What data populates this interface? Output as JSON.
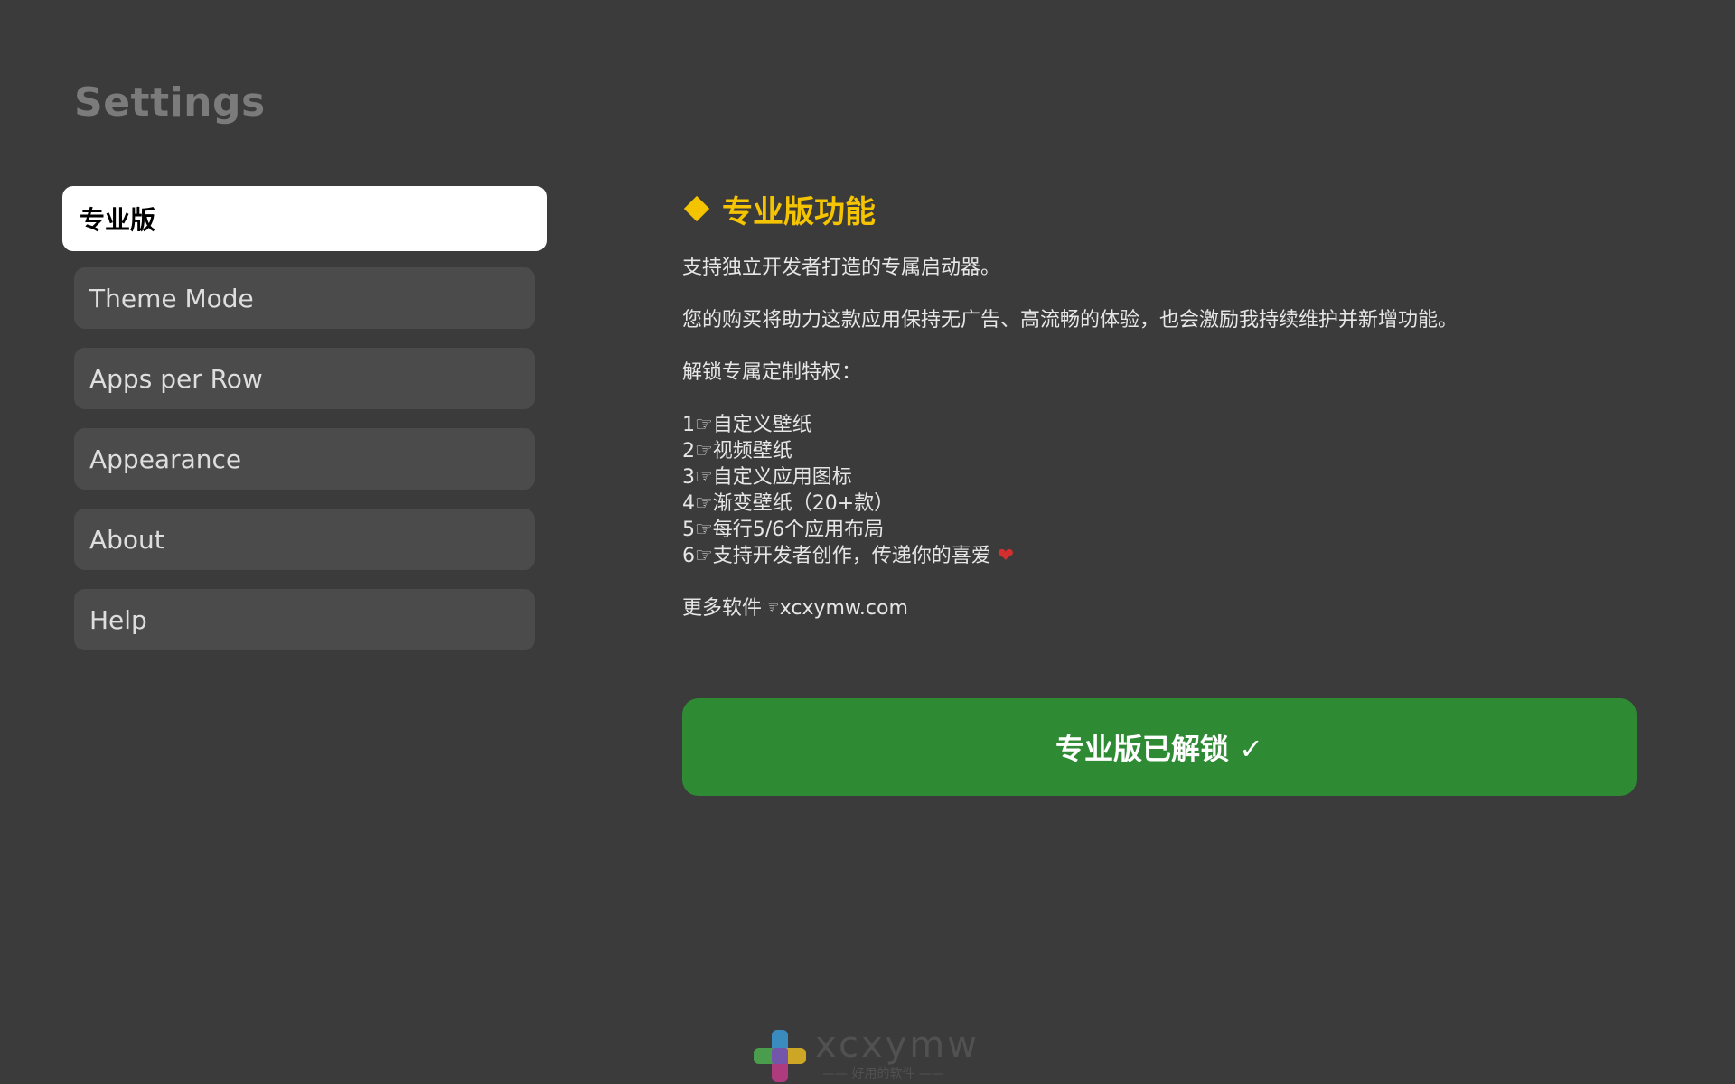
{
  "page_title": "Settings",
  "nav": {
    "items": [
      {
        "label": "专业版",
        "active": true
      },
      {
        "label": "Theme Mode",
        "active": false
      },
      {
        "label": "Apps per Row",
        "active": false
      },
      {
        "label": "Appearance",
        "active": false
      },
      {
        "label": "About",
        "active": false
      },
      {
        "label": "Help",
        "active": false
      }
    ]
  },
  "content": {
    "heading": "专业版功能",
    "heading_icon": "diamond-icon",
    "para1": "支持独立开发者打造的专属启动器。",
    "para2": "您的购买将助力这款应用保持无广告、高流畅的体验，也会激励我持续维护并新增功能。",
    "para3": "解锁专属定制特权：",
    "features": [
      "1☞自定义壁纸",
      "2☞视频壁纸",
      "3☞自定义应用图标",
      "4☞渐变壁纸（20+款）",
      "5☞每行5/6个应用布局",
      "6☞支持开发者创作，传递你的喜爱"
    ],
    "heart": "❤",
    "more": "更多软件☞xcxymw.com"
  },
  "unlock_button": "专业版已解锁 ✓",
  "watermark": {
    "text": "xcxymw",
    "sub": "—— 好用的软件 ——"
  },
  "colors": {
    "background": "#3b3b3b",
    "accent_yellow": "#f5c400",
    "button_green": "#2e8b34",
    "nav_item": "#4b4b4b",
    "nav_active": "#ffffff"
  }
}
